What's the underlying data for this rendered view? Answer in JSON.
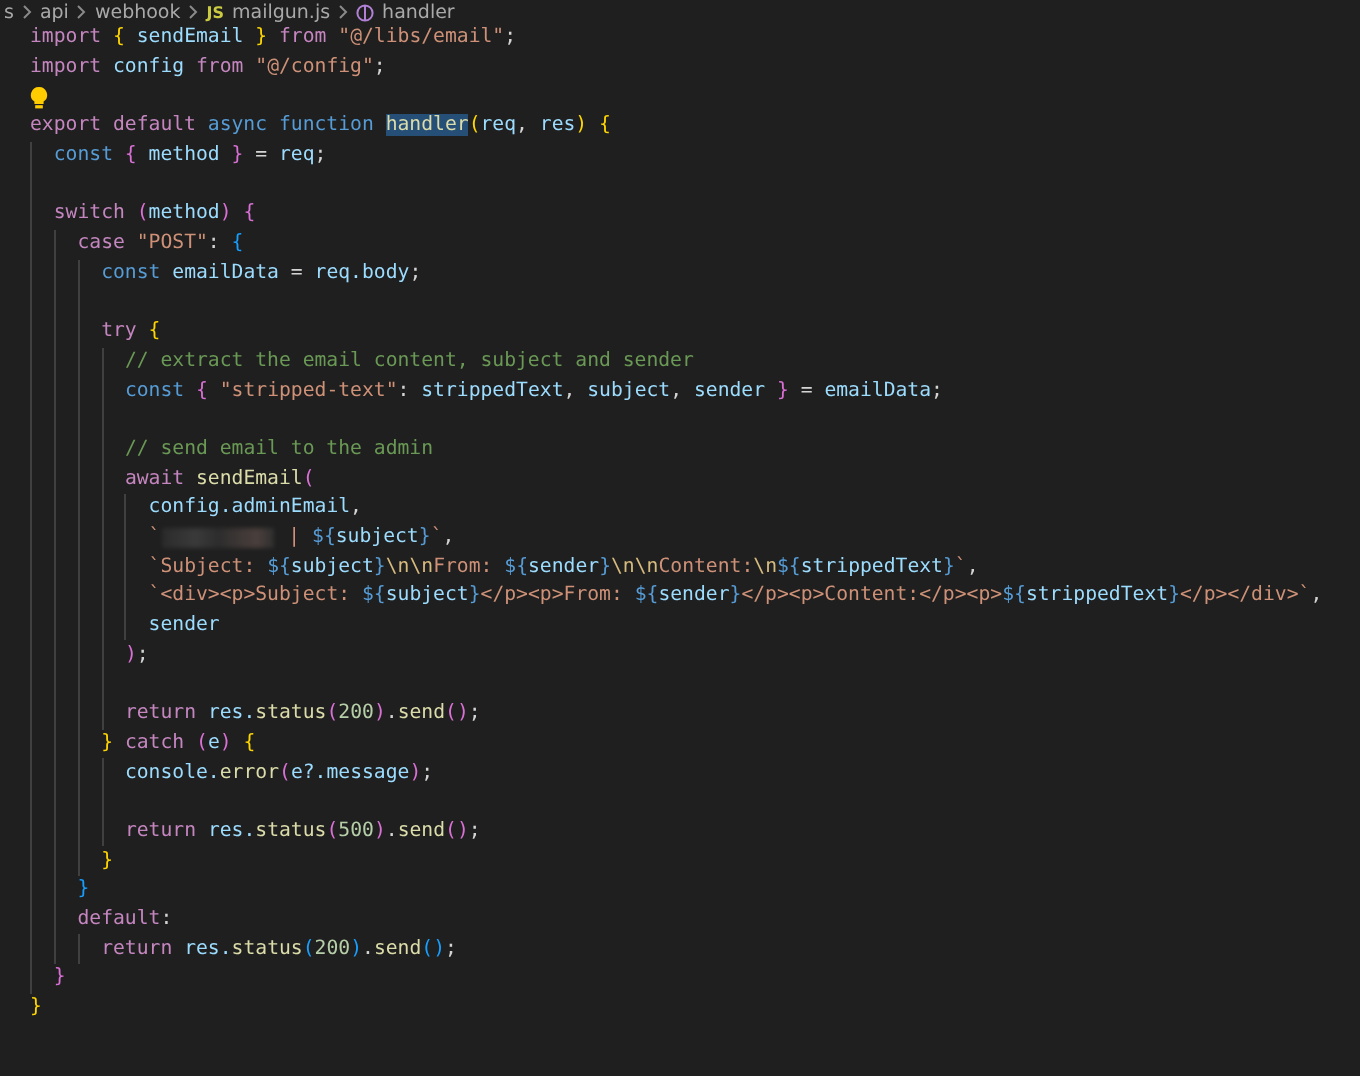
{
  "breadcrumb": {
    "items": [
      {
        "kind": "folder",
        "label": "s"
      },
      {
        "kind": "folder",
        "label": "api"
      },
      {
        "kind": "folder",
        "label": "webhook"
      },
      {
        "kind": "file",
        "badge": "JS",
        "label": "mailgun.js"
      },
      {
        "kind": "symbol",
        "label": "handler"
      }
    ]
  },
  "lines": [
    {
      "kind": "code",
      "tokens": [
        {
          "kind": "keyword",
          "text": "import "
        },
        {
          "kind": "brace1",
          "text": "{"
        },
        {
          "kind": "variable",
          "text": " sendEmail "
        },
        {
          "kind": "brace1",
          "text": "}"
        },
        {
          "kind": "keyword",
          "text": " from "
        },
        {
          "kind": "string",
          "text": "\"@/libs/email\""
        },
        {
          "kind": "plain",
          "text": ";"
        }
      ]
    },
    {
      "kind": "code",
      "tokens": [
        {
          "kind": "keyword",
          "text": "import "
        },
        {
          "kind": "variable",
          "text": "config "
        },
        {
          "kind": "keyword",
          "text": "from "
        },
        {
          "kind": "string",
          "text": "\"@/config\""
        },
        {
          "kind": "plain",
          "text": ";"
        }
      ]
    },
    {
      "kind": "hint"
    },
    {
      "kind": "code",
      "tokens": [
        {
          "kind": "keyword",
          "text": "export default "
        },
        {
          "kind": "storage",
          "text": "async function "
        },
        {
          "kind": "highlight",
          "text": "handler"
        },
        {
          "kind": "brace1",
          "text": "("
        },
        {
          "kind": "variable",
          "text": "req"
        },
        {
          "kind": "plain",
          "text": ", "
        },
        {
          "kind": "variable",
          "text": "res"
        },
        {
          "kind": "brace1",
          "text": ") {"
        }
      ],
      "children": [
        {
          "kind": "code",
          "tokens": [
            {
              "kind": "storage",
              "text": "const "
            },
            {
              "kind": "brace2",
              "text": "{"
            },
            {
              "kind": "variable",
              "text": " method "
            },
            {
              "kind": "brace2",
              "text": "}"
            },
            {
              "kind": "plain",
              "text": " = "
            },
            {
              "kind": "variable",
              "text": "req"
            },
            {
              "kind": "plain",
              "text": ";"
            }
          ]
        },
        {
          "kind": "blank"
        },
        {
          "kind": "code",
          "tokens": [
            {
              "kind": "keyword",
              "text": "switch "
            },
            {
              "kind": "brace2",
              "text": "("
            },
            {
              "kind": "variable",
              "text": "method"
            },
            {
              "kind": "brace2",
              "text": ") {"
            }
          ],
          "children": [
            {
              "kind": "code",
              "tokens": [
                {
                  "kind": "keyword",
                  "text": "case "
                },
                {
                  "kind": "string",
                  "text": "\"POST\""
                },
                {
                  "kind": "plain",
                  "text": ": "
                },
                {
                  "kind": "brace3",
                  "text": "{"
                }
              ],
              "children": [
                {
                  "kind": "code",
                  "tokens": [
                    {
                      "kind": "storage",
                      "text": "const "
                    },
                    {
                      "kind": "variable",
                      "text": "emailData"
                    },
                    {
                      "kind": "plain",
                      "text": " = "
                    },
                    {
                      "kind": "variable",
                      "text": "req.body"
                    },
                    {
                      "kind": "plain",
                      "text": ";"
                    }
                  ]
                },
                {
                  "kind": "blank"
                },
                {
                  "kind": "code",
                  "tokens": [
                    {
                      "kind": "keyword",
                      "text": "try "
                    },
                    {
                      "kind": "brace1",
                      "text": "{"
                    }
                  ],
                  "children": [
                    {
                      "kind": "code",
                      "tokens": [
                        {
                          "kind": "comment",
                          "text": "// extract the email content, subject and sender"
                        }
                      ]
                    },
                    {
                      "kind": "code",
                      "tokens": [
                        {
                          "kind": "storage",
                          "text": "const "
                        },
                        {
                          "kind": "brace2",
                          "text": "{ "
                        },
                        {
                          "kind": "string",
                          "text": "\"stripped-text\""
                        },
                        {
                          "kind": "plain",
                          "text": ": "
                        },
                        {
                          "kind": "variable",
                          "text": "strippedText"
                        },
                        {
                          "kind": "plain",
                          "text": ", "
                        },
                        {
                          "kind": "variable",
                          "text": "subject"
                        },
                        {
                          "kind": "plain",
                          "text": ", "
                        },
                        {
                          "kind": "variable",
                          "text": "sender "
                        },
                        {
                          "kind": "brace2",
                          "text": "}"
                        },
                        {
                          "kind": "plain",
                          "text": " = "
                        },
                        {
                          "kind": "variable",
                          "text": "emailData"
                        },
                        {
                          "kind": "plain",
                          "text": ";"
                        }
                      ]
                    },
                    {
                      "kind": "blank"
                    },
                    {
                      "kind": "code",
                      "tokens": [
                        {
                          "kind": "comment",
                          "text": "// send email to the admin"
                        }
                      ]
                    },
                    {
                      "kind": "code",
                      "tokens": [
                        {
                          "kind": "keyword",
                          "text": "await "
                        },
                        {
                          "kind": "function",
                          "text": "sendEmail"
                        },
                        {
                          "kind": "brace2",
                          "text": "("
                        }
                      ],
                      "children": [
                        {
                          "kind": "code",
                          "tokens": [
                            {
                              "kind": "variable",
                              "text": "config.adminEmail"
                            },
                            {
                              "kind": "plain",
                              "text": ","
                            }
                          ]
                        },
                        {
                          "kind": "redacted",
                          "before": [
                            {
                              "kind": "string",
                              "text": "`"
                            }
                          ],
                          "after": [
                            {
                              "kind": "string",
                              "text": " | "
                            },
                            {
                              "kind": "template",
                              "text": "${"
                            },
                            {
                              "kind": "variable",
                              "text": "subject"
                            },
                            {
                              "kind": "template",
                              "text": "}"
                            },
                            {
                              "kind": "string",
                              "text": "`"
                            },
                            {
                              "kind": "plain",
                              "text": ","
                            }
                          ]
                        },
                        {
                          "kind": "code",
                          "tokens": [
                            {
                              "kind": "string",
                              "text": "`Subject: "
                            },
                            {
                              "kind": "template",
                              "text": "${"
                            },
                            {
                              "kind": "variable",
                              "text": "subject"
                            },
                            {
                              "kind": "template",
                              "text": "}"
                            },
                            {
                              "kind": "escape",
                              "text": "\\n\\n"
                            },
                            {
                              "kind": "string",
                              "text": "From: "
                            },
                            {
                              "kind": "template",
                              "text": "${"
                            },
                            {
                              "kind": "variable",
                              "text": "sender"
                            },
                            {
                              "kind": "template",
                              "text": "}"
                            },
                            {
                              "kind": "escape",
                              "text": "\\n\\n"
                            },
                            {
                              "kind": "string",
                              "text": "Content:"
                            },
                            {
                              "kind": "escape",
                              "text": "\\n"
                            },
                            {
                              "kind": "template",
                              "text": "${"
                            },
                            {
                              "kind": "variable",
                              "text": "strippedText"
                            },
                            {
                              "kind": "template",
                              "text": "}"
                            },
                            {
                              "kind": "string",
                              "text": "`"
                            },
                            {
                              "kind": "plain",
                              "text": ","
                            }
                          ]
                        },
                        {
                          "kind": "code",
                          "tokens": [
                            {
                              "kind": "string",
                              "text": "`<div><p>Subject: "
                            },
                            {
                              "kind": "template",
                              "text": "${"
                            },
                            {
                              "kind": "variable",
                              "text": "subject"
                            },
                            {
                              "kind": "template",
                              "text": "}"
                            },
                            {
                              "kind": "string",
                              "text": "</p><p>From: "
                            },
                            {
                              "kind": "template",
                              "text": "${"
                            },
                            {
                              "kind": "variable",
                              "text": "sender"
                            },
                            {
                              "kind": "template",
                              "text": "}"
                            },
                            {
                              "kind": "string",
                              "text": "</p><p>Content:</p><p>"
                            },
                            {
                              "kind": "template",
                              "text": "${"
                            },
                            {
                              "kind": "variable",
                              "text": "strippedText"
                            },
                            {
                              "kind": "template",
                              "text": "}"
                            },
                            {
                              "kind": "string",
                              "text": "</p></div>`"
                            },
                            {
                              "kind": "plain",
                              "text": ","
                            }
                          ]
                        },
                        {
                          "kind": "code",
                          "tokens": [
                            {
                              "kind": "variable",
                              "text": "sender"
                            }
                          ]
                        }
                      ]
                    },
                    {
                      "kind": "code",
                      "tokens": [
                        {
                          "kind": "brace2",
                          "text": ")"
                        },
                        {
                          "kind": "plain",
                          "text": ";"
                        }
                      ]
                    },
                    {
                      "kind": "blank"
                    },
                    {
                      "kind": "code",
                      "tokens": [
                        {
                          "kind": "keyword",
                          "text": "return "
                        },
                        {
                          "kind": "variable",
                          "text": "res."
                        },
                        {
                          "kind": "function",
                          "text": "status"
                        },
                        {
                          "kind": "brace2",
                          "text": "("
                        },
                        {
                          "kind": "number",
                          "text": "200"
                        },
                        {
                          "kind": "brace2",
                          "text": ")"
                        },
                        {
                          "kind": "plain",
                          "text": "."
                        },
                        {
                          "kind": "function",
                          "text": "send"
                        },
                        {
                          "kind": "brace2",
                          "text": "()"
                        },
                        {
                          "kind": "plain",
                          "text": ";"
                        }
                      ]
                    }
                  ]
                },
                {
                  "kind": "code",
                  "tokens": [
                    {
                      "kind": "brace1",
                      "text": "}"
                    },
                    {
                      "kind": "keyword",
                      "text": " catch "
                    },
                    {
                      "kind": "brace2",
                      "text": "("
                    },
                    {
                      "kind": "variable",
                      "text": "e"
                    },
                    {
                      "kind": "brace2",
                      "text": ") "
                    },
                    {
                      "kind": "brace1",
                      "text": "{"
                    }
                  ],
                  "children": [
                    {
                      "kind": "code",
                      "tokens": [
                        {
                          "kind": "variable",
                          "text": "console."
                        },
                        {
                          "kind": "function",
                          "text": "error"
                        },
                        {
                          "kind": "brace2",
                          "text": "("
                        },
                        {
                          "kind": "variable",
                          "text": "e?.message"
                        },
                        {
                          "kind": "brace2",
                          "text": ")"
                        },
                        {
                          "kind": "plain",
                          "text": ";"
                        }
                      ]
                    },
                    {
                      "kind": "blank"
                    },
                    {
                      "kind": "code",
                      "tokens": [
                        {
                          "kind": "keyword",
                          "text": "return "
                        },
                        {
                          "kind": "variable",
                          "text": "res."
                        },
                        {
                          "kind": "function",
                          "text": "status"
                        },
                        {
                          "kind": "brace2",
                          "text": "("
                        },
                        {
                          "kind": "number",
                          "text": "500"
                        },
                        {
                          "kind": "brace2",
                          "text": ")"
                        },
                        {
                          "kind": "plain",
                          "text": "."
                        },
                        {
                          "kind": "function",
                          "text": "send"
                        },
                        {
                          "kind": "brace2",
                          "text": "()"
                        },
                        {
                          "kind": "plain",
                          "text": ";"
                        }
                      ]
                    }
                  ]
                },
                {
                  "kind": "code",
                  "tokens": [
                    {
                      "kind": "brace1",
                      "text": "}"
                    }
                  ]
                }
              ]
            },
            {
              "kind": "code",
              "tokens": [
                {
                  "kind": "brace3",
                  "text": "}"
                }
              ]
            },
            {
              "kind": "code",
              "tokens": [
                {
                  "kind": "keyword",
                  "text": "default"
                },
                {
                  "kind": "plain",
                  "text": ":"
                }
              ],
              "children": [
                {
                  "kind": "code",
                  "tokens": [
                    {
                      "kind": "keyword",
                      "text": "return "
                    },
                    {
                      "kind": "variable",
                      "text": "res."
                    },
                    {
                      "kind": "function",
                      "text": "status"
                    },
                    {
                      "kind": "brace3",
                      "text": "("
                    },
                    {
                      "kind": "number",
                      "text": "200"
                    },
                    {
                      "kind": "brace3",
                      "text": ")"
                    },
                    {
                      "kind": "plain",
                      "text": "."
                    },
                    {
                      "kind": "function",
                      "text": "send"
                    },
                    {
                      "kind": "brace3",
                      "text": "()"
                    },
                    {
                      "kind": "plain",
                      "text": ";"
                    }
                  ]
                }
              ]
            }
          ]
        },
        {
          "kind": "code",
          "tokens": [
            {
              "kind": "brace2",
              "text": "}"
            }
          ]
        }
      ]
    },
    {
      "kind": "code",
      "tokens": [
        {
          "kind": "brace1",
          "text": "}"
        }
      ]
    }
  ]
}
